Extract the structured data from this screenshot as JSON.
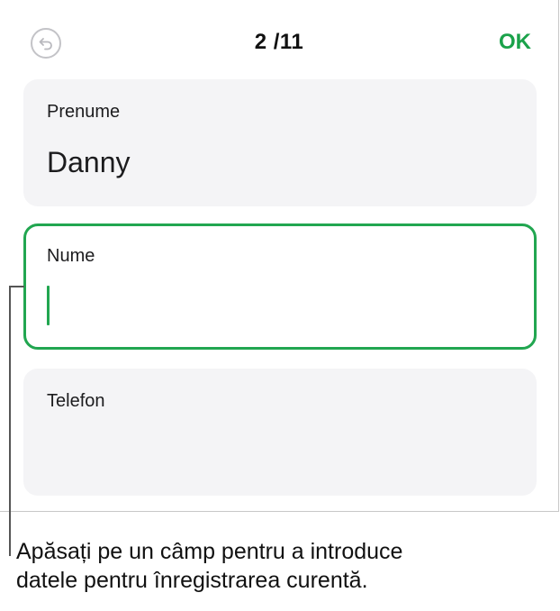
{
  "toolbar": {
    "undo_icon": "undo-arrow-icon",
    "counter": "2 /11",
    "ok_label": "OK"
  },
  "fields": [
    {
      "label": "Prenume",
      "value": "Danny",
      "state": "filled"
    },
    {
      "label": "Nume",
      "value": "",
      "state": "editing"
    },
    {
      "label": "Telefon",
      "value": "",
      "state": "empty"
    }
  ],
  "caption": {
    "line1": "Apăsați pe un câmp pentru a introduce",
    "line2": "datele pentru înregistrarea curentă."
  },
  "colors": {
    "accent": "#21a650",
    "card_background": "#f4f4f6"
  }
}
